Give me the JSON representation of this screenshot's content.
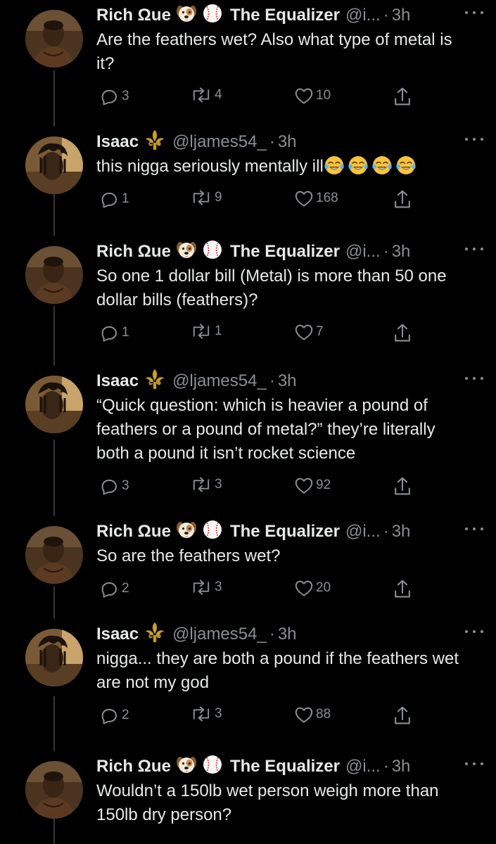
{
  "colors": {
    "background": "#000000",
    "text": "#e7e9ea",
    "muted": "#8b8f94",
    "thread_line": "#333639"
  },
  "tweets": [
    {
      "name": "Rich Ωue",
      "badges": [
        "dog-face-emoji",
        "baseball-emoji"
      ],
      "display_name_2": "The Equalizer",
      "handle": "@i...",
      "dot": "·",
      "time": "3h",
      "text": "Are the feathers wet? Also what type of metal is it?",
      "emojis": [],
      "replies": "3",
      "retweets": "4",
      "likes": "10"
    },
    {
      "name": "Isaac",
      "badges": [
        "fleur-de-lis-emoji"
      ],
      "display_name_2": "",
      "handle": "@ljames54_",
      "dot": "·",
      "time": "3h",
      "text": "this nigga seriously mentally ill",
      "emojis": [
        "tears-of-joy-emoji",
        "tears-of-joy-emoji",
        "tears-of-joy-emoji",
        "tears-of-joy-emoji"
      ],
      "replies": "1",
      "retweets": "9",
      "likes": "168"
    },
    {
      "name": "Rich Ωue",
      "badges": [
        "dog-face-emoji",
        "baseball-emoji"
      ],
      "display_name_2": "The Equalizer",
      "handle": "@i...",
      "dot": "·",
      "time": "3h",
      "text": "So one 1 dollar bill (Metal) is more than 50 one dollar bills (feathers)?",
      "emojis": [],
      "replies": "1",
      "retweets": "1",
      "likes": "7"
    },
    {
      "name": "Isaac",
      "badges": [
        "fleur-de-lis-emoji"
      ],
      "display_name_2": "",
      "handle": "@ljames54_",
      "dot": "·",
      "time": "3h",
      "text": "“Quick question: which is heavier a pound of feathers or a pound of metal?” they’re literally both a pound it isn’t rocket science",
      "emojis": [],
      "replies": "3",
      "retweets": "3",
      "likes": "92"
    },
    {
      "name": "Rich Ωue",
      "badges": [
        "dog-face-emoji",
        "baseball-emoji"
      ],
      "display_name_2": "The Equalizer",
      "handle": "@i...",
      "dot": "·",
      "time": "3h",
      "text": "So are the feathers wet?",
      "emojis": [],
      "replies": "2",
      "retweets": "3",
      "likes": "20"
    },
    {
      "name": "Isaac",
      "badges": [
        "fleur-de-lis-emoji"
      ],
      "display_name_2": "",
      "handle": "@ljames54_",
      "dot": "·",
      "time": "3h",
      "text": "nigga... they are both a pound if the feathers wet are not my god",
      "emojis": [],
      "replies": "2",
      "retweets": "3",
      "likes": "88"
    },
    {
      "name": "Rich Ωue",
      "badges": [
        "dog-face-emoji",
        "baseball-emoji"
      ],
      "display_name_2": "The Equalizer",
      "handle": "@i...",
      "dot": "·",
      "time": "3h",
      "text": "Wouldn’t a 150lb wet person weigh more than 150lb dry person?",
      "emojis": [],
      "replies": "",
      "retweets": "",
      "likes": ""
    }
  ]
}
